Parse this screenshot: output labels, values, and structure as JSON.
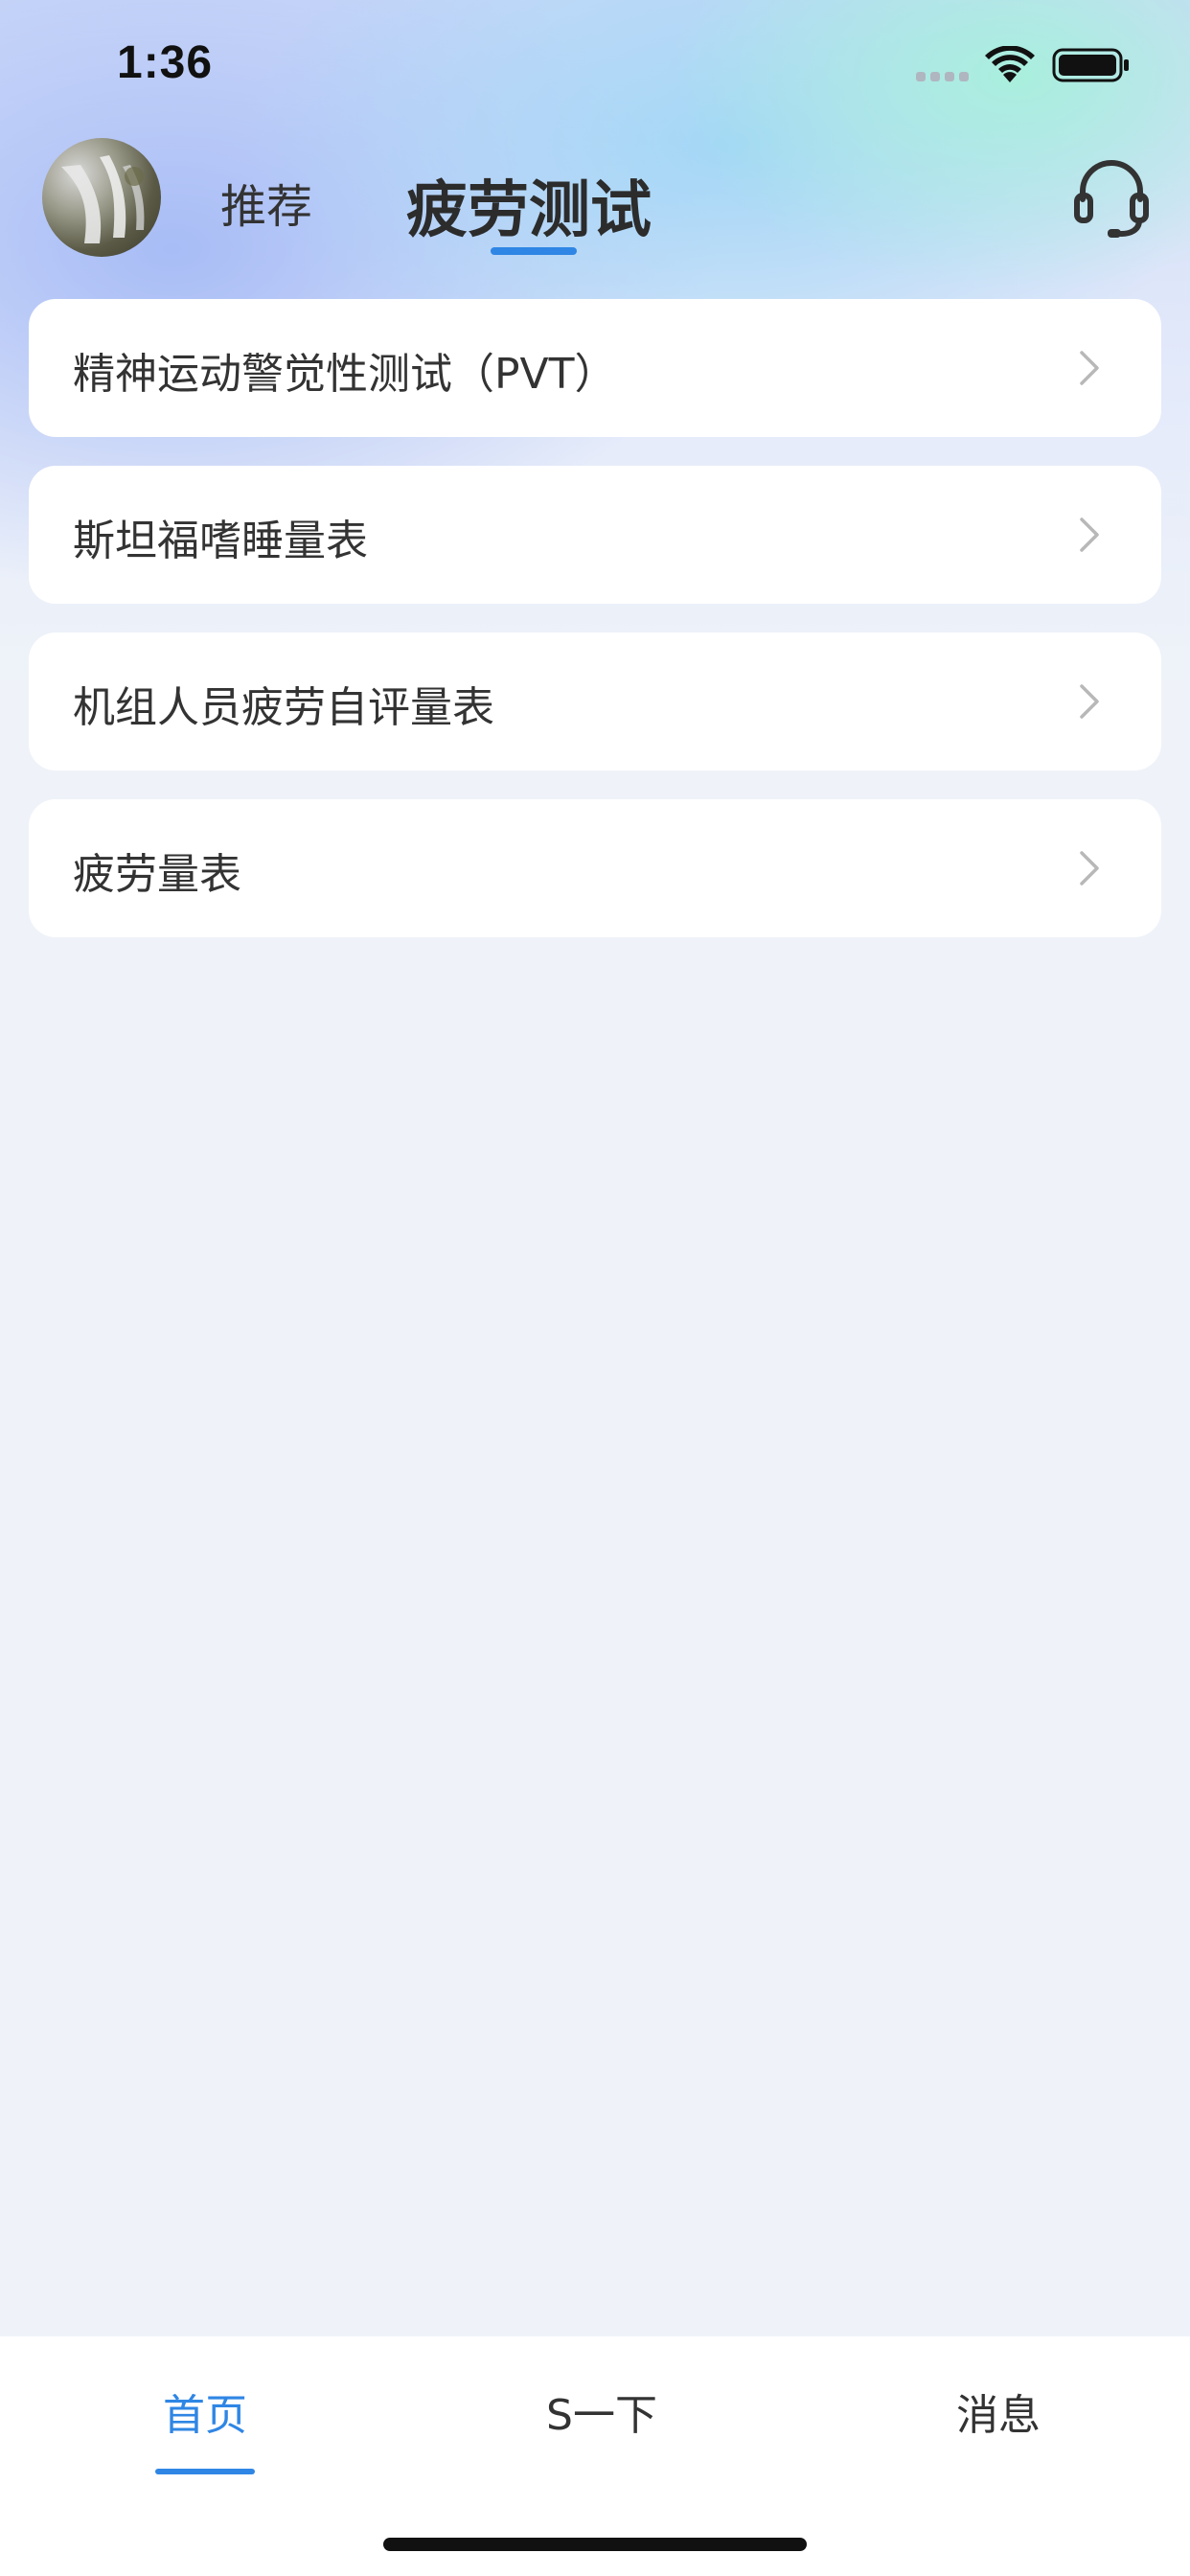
{
  "status_bar": {
    "time": "1:36"
  },
  "header": {
    "tabs": [
      {
        "label": "推荐",
        "active": false
      },
      {
        "label": "疲劳测试",
        "active": true
      }
    ],
    "support_icon": "headset-icon"
  },
  "list": {
    "items": [
      {
        "label": "精神运动警觉性测试（PVT）"
      },
      {
        "label": "斯坦福嗜睡量表"
      },
      {
        "label": "机组人员疲劳自评量表"
      },
      {
        "label": "疲劳量表"
      }
    ]
  },
  "tab_bar": {
    "items": [
      {
        "label": "首页",
        "active": true
      },
      {
        "label": "S一下",
        "active": false
      },
      {
        "label": "消息",
        "active": false
      }
    ]
  },
  "colors": {
    "accent": "#2f86e4",
    "background": "#eff3f9",
    "card": "#ffffff",
    "text": "#333333"
  }
}
